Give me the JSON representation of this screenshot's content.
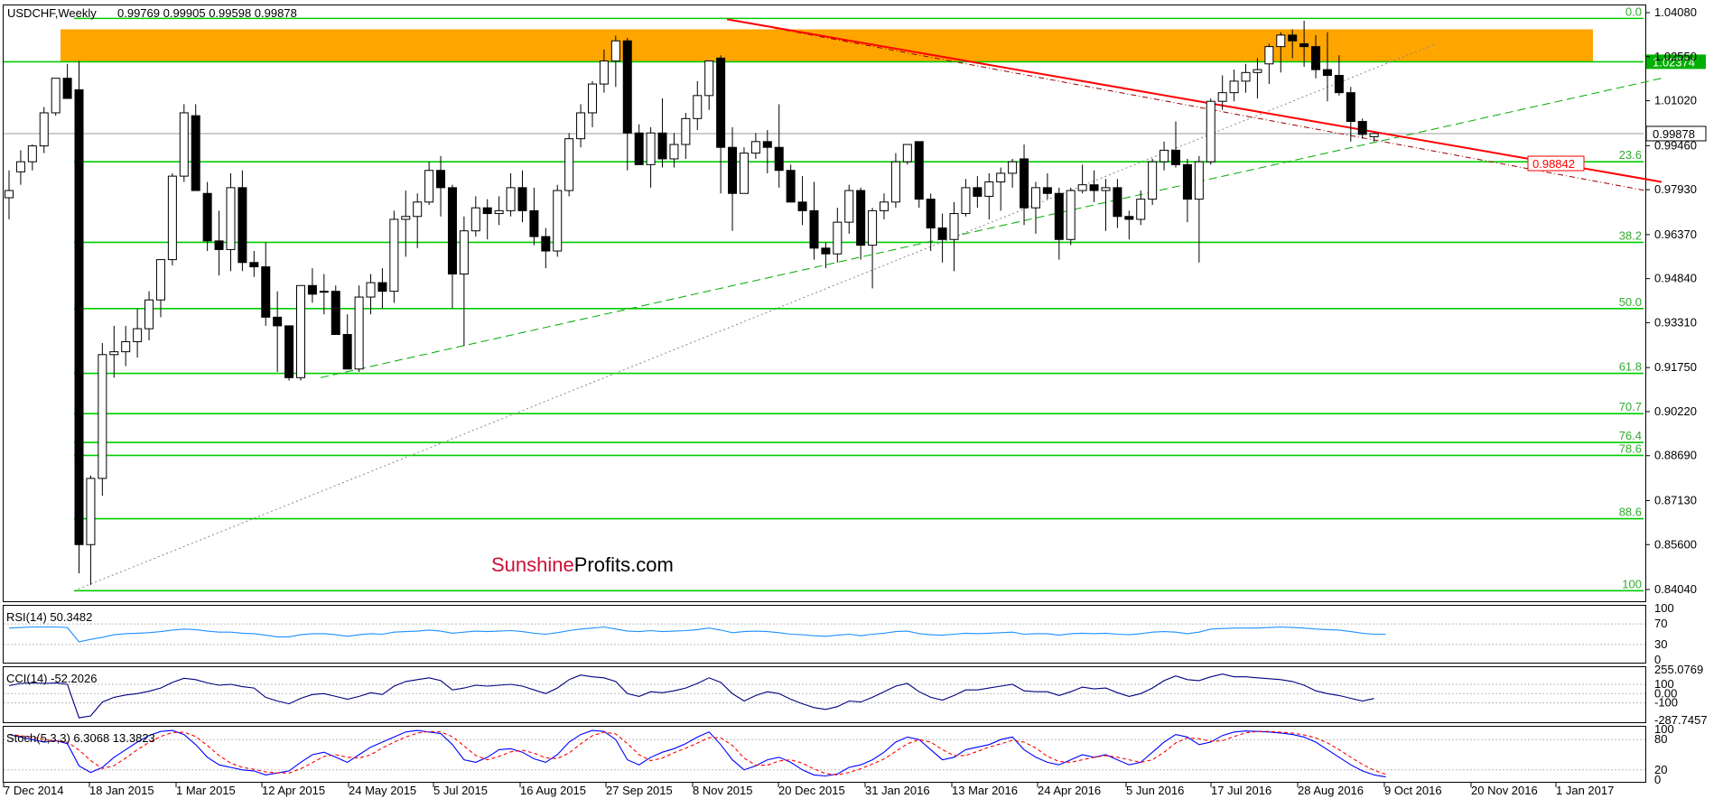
{
  "chart_data": {
    "type": "candlestick",
    "title": "USDCHF,Weekly",
    "ohlc_header": "0.99769 0.99905 0.99598 0.99878",
    "watermark": {
      "part1": "Sunshine",
      "part2": "Profits.com",
      "color1": "#cc1133",
      "color2": "#000000"
    },
    "price_axis_ticks": [
      "1.04080",
      "1.02550",
      "1.01020",
      "0.99460",
      "0.97930",
      "0.96370",
      "0.94840",
      "0.93310",
      "0.91750",
      "0.90220",
      "0.88690",
      "0.87130",
      "0.85600",
      "0.84040"
    ],
    "x_tick_labels": [
      "7 Dec 2014",
      "18 Jan 2015",
      "1 Mar 2015",
      "12 Apr 2015",
      "24 May 2015",
      "5 Jul 2015",
      "16 Aug 2015",
      "27 Sep 2015",
      "8 Nov 2015",
      "20 Dec 2015",
      "31 Jan 2016",
      "13 Mar 2016",
      "24 Apr 2016",
      "5 Jun 2016",
      "17 Jul 2016",
      "28 Aug 2016",
      "9 Oct 2016",
      "20 Nov 2016",
      "1 Jan 2017"
    ],
    "fib_levels": [
      {
        "label": "0.0",
        "price": 1.0388
      },
      {
        "label": "23.6",
        "price": 0.989
      },
      {
        "label": "38.2",
        "price": 0.961
      },
      {
        "label": "50.0",
        "price": 0.938
      },
      {
        "label": "61.8",
        "price": 0.9155
      },
      {
        "label": "70.7",
        "price": 0.9015
      },
      {
        "label": "76.4",
        "price": 0.8915
      },
      {
        "label": "78.6",
        "price": 0.887
      },
      {
        "label": "88.6",
        "price": 0.865
      },
      {
        "label": "100",
        "price": 0.84
      }
    ],
    "resistance_zone": {
      "low": 1.0237,
      "high": 1.035,
      "color": "#ffa500"
    },
    "labels": {
      "resistance": {
        "text": "1.02374",
        "price": 1.02374,
        "bg": "#00b000"
      },
      "current": {
        "text": "0.99878",
        "price": 0.99878
      },
      "trendline": {
        "text": "0.98842",
        "price": 0.98842,
        "color": "#ff0000"
      }
    },
    "candles": [
      [
        0.9765,
        0.986,
        0.969,
        0.979
      ],
      [
        0.9855,
        0.993,
        0.981,
        0.989
      ],
      [
        0.989,
        0.995,
        0.986,
        0.9945
      ],
      [
        0.9945,
        1.008,
        0.992,
        1.006
      ],
      [
        1.006,
        1.018,
        1.005,
        1.018
      ],
      [
        1.018,
        1.023,
        1.012,
        1.011
      ],
      [
        1.014,
        1.024,
        0.846,
        0.856
      ],
      [
        0.856,
        0.88,
        0.842,
        0.879
      ],
      [
        0.879,
        0.926,
        0.873,
        0.922
      ],
      [
        0.922,
        0.932,
        0.914,
        0.923
      ],
      [
        0.923,
        0.932,
        0.918,
        0.9265
      ],
      [
        0.9265,
        0.938,
        0.921,
        0.931
      ],
      [
        0.931,
        0.944,
        0.927,
        0.941
      ],
      [
        0.941,
        0.955,
        0.935,
        0.955
      ],
      [
        0.955,
        0.985,
        0.953,
        0.984
      ],
      [
        0.984,
        1.009,
        0.982,
        1.006
      ],
      [
        1.005,
        1.009,
        0.979,
        0.979
      ],
      [
        0.978,
        0.982,
        0.958,
        0.9615
      ],
      [
        0.9615,
        0.972,
        0.9495,
        0.9585
      ],
      [
        0.9585,
        0.985,
        0.951,
        0.98
      ],
      [
        0.98,
        0.986,
        0.951,
        0.954
      ],
      [
        0.954,
        0.958,
        0.949,
        0.9525
      ],
      [
        0.9525,
        0.961,
        0.932,
        0.935
      ],
      [
        0.935,
        0.944,
        0.916,
        0.932
      ],
      [
        0.932,
        0.928,
        0.913,
        0.914
      ],
      [
        0.914,
        0.945,
        0.913,
        0.946
      ],
      [
        0.946,
        0.952,
        0.94,
        0.943
      ],
      [
        0.944,
        0.95,
        0.936,
        0.944
      ],
      [
        0.944,
        0.946,
        0.929,
        0.929
      ],
      [
        0.929,
        0.936,
        0.918,
        0.917
      ],
      [
        0.917,
        0.946,
        0.916,
        0.942
      ],
      [
        0.942,
        0.95,
        0.936,
        0.947
      ],
      [
        0.947,
        0.952,
        0.938,
        0.944
      ],
      [
        0.944,
        0.972,
        0.94,
        0.969
      ],
      [
        0.969,
        0.979,
        0.956,
        0.97
      ],
      [
        0.97,
        0.978,
        0.959,
        0.975
      ],
      [
        0.975,
        0.989,
        0.974,
        0.986
      ],
      [
        0.986,
        0.991,
        0.97,
        0.98
      ],
      [
        0.98,
        0.981,
        0.938,
        0.95
      ],
      [
        0.95,
        0.97,
        0.925,
        0.965
      ],
      [
        0.965,
        0.977,
        0.963,
        0.973
      ],
      [
        0.973,
        0.976,
        0.962,
        0.971
      ],
      [
        0.971,
        0.977,
        0.967,
        0.972
      ],
      [
        0.972,
        0.985,
        0.97,
        0.98
      ],
      [
        0.98,
        0.986,
        0.968,
        0.972
      ],
      [
        0.972,
        0.98,
        0.96,
        0.963
      ],
      [
        0.963,
        0.966,
        0.952,
        0.958
      ],
      [
        0.958,
        0.981,
        0.956,
        0.979
      ],
      [
        0.979,
        0.999,
        0.977,
        0.997
      ],
      [
        0.997,
        1.009,
        0.994,
        1.006
      ],
      [
        1.006,
        1.017,
        1.001,
        1.016
      ],
      [
        1.016,
        1.028,
        1.013,
        1.024
      ],
      [
        1.024,
        1.0328,
        1.015,
        1.031
      ],
      [
        1.031,
        1.032,
        0.986,
        0.999
      ],
      [
        0.999,
        1.002,
        0.988,
        0.988
      ],
      [
        0.988,
        1.001,
        0.98,
        0.999
      ],
      [
        0.999,
        1.011,
        0.987,
        0.99
      ],
      [
        0.99,
        0.999,
        0.987,
        0.995
      ],
      [
        0.995,
        1.006,
        0.99,
        1.004
      ],
      [
        1.004,
        1.017,
        1.0,
        1.012
      ],
      [
        1.012,
        1.024,
        1.007,
        1.024
      ],
      [
        1.025,
        1.026,
        0.978,
        0.994
      ],
      [
        0.994,
        1.001,
        0.965,
        0.978
      ],
      [
        0.978,
        0.994,
        0.979,
        0.992
      ],
      [
        0.992,
        0.999,
        0.99,
        0.996
      ],
      [
        0.996,
        1.0,
        0.985,
        0.994
      ],
      [
        0.994,
        1.009,
        0.98,
        0.986
      ],
      [
        0.986,
        0.988,
        0.975,
        0.975
      ],
      [
        0.975,
        0.984,
        0.967,
        0.972
      ],
      [
        0.972,
        0.982,
        0.955,
        0.959
      ],
      [
        0.959,
        0.961,
        0.952,
        0.957
      ],
      [
        0.957,
        0.973,
        0.954,
        0.968
      ],
      [
        0.968,
        0.981,
        0.964,
        0.979
      ],
      [
        0.979,
        0.98,
        0.955,
        0.96
      ],
      [
        0.96,
        0.973,
        0.945,
        0.972
      ],
      [
        0.972,
        0.978,
        0.969,
        0.975
      ],
      [
        0.975,
        0.992,
        0.973,
        0.989
      ],
      [
        0.989,
        0.995,
        0.988,
        0.995
      ],
      [
        0.996,
        0.996,
        0.973,
        0.976
      ],
      [
        0.976,
        0.978,
        0.958,
        0.966
      ],
      [
        0.966,
        0.971,
        0.954,
        0.962
      ],
      [
        0.962,
        0.975,
        0.951,
        0.971
      ],
      [
        0.971,
        0.983,
        0.97,
        0.98
      ],
      [
        0.98,
        0.984,
        0.973,
        0.977
      ],
      [
        0.977,
        0.985,
        0.969,
        0.982
      ],
      [
        0.982,
        0.987,
        0.972,
        0.985
      ],
      [
        0.985,
        0.99,
        0.98,
        0.989
      ],
      [
        0.99,
        0.995,
        0.967,
        0.973
      ],
      [
        0.973,
        0.982,
        0.964,
        0.98
      ],
      [
        0.98,
        0.985,
        0.976,
        0.978
      ],
      [
        0.978,
        0.98,
        0.955,
        0.962
      ],
      [
        0.962,
        0.98,
        0.96,
        0.979
      ],
      [
        0.979,
        0.988,
        0.978,
        0.981
      ],
      [
        0.981,
        0.986,
        0.975,
        0.979
      ],
      [
        0.979,
        0.983,
        0.965,
        0.98
      ],
      [
        0.98,
        0.983,
        0.966,
        0.97
      ],
      [
        0.97,
        0.972,
        0.962,
        0.969
      ],
      [
        0.969,
        0.979,
        0.967,
        0.976
      ],
      [
        0.976,
        0.99,
        0.974,
        0.989
      ],
      [
        0.989,
        0.996,
        0.986,
        0.993
      ],
      [
        0.993,
        1.003,
        0.987,
        0.988
      ],
      [
        0.988,
        0.99,
        0.968,
        0.976
      ],
      [
        0.976,
        0.991,
        0.954,
        0.989
      ],
      [
        0.989,
        1.011,
        0.988,
        1.01
      ],
      [
        1.01,
        1.019,
        1.007,
        1.013
      ],
      [
        1.013,
        1.021,
        1.01,
        1.017
      ],
      [
        1.017,
        1.023,
        1.013,
        1.02
      ],
      [
        1.02,
        1.025,
        1.011,
        1.021
      ],
      [
        1.023,
        1.03,
        1.016,
        1.029
      ],
      [
        1.029,
        1.034,
        1.02,
        1.033
      ],
      [
        1.033,
        1.035,
        1.025,
        1.031
      ],
      [
        1.03,
        1.038,
        1.022,
        1.029
      ],
      [
        1.029,
        1.033,
        1.018,
        1.021
      ],
      [
        1.021,
        1.034,
        1.01,
        1.019
      ],
      [
        1.019,
        1.026,
        1.012,
        1.013
      ],
      [
        1.013,
        1.015,
        0.996,
        1.003
      ],
      [
        1.003,
        1.004,
        0.997,
        0.9985
      ],
      [
        0.9977,
        0.9991,
        0.996,
        0.9988
      ]
    ],
    "rsi": {
      "label": "RSI(14) 50.3482",
      "ticks": [
        "100",
        "70",
        "30",
        "0"
      ],
      "values": [
        62,
        63,
        64,
        64,
        64,
        63,
        35,
        40,
        44,
        49,
        51,
        52,
        53,
        55,
        58,
        60,
        59,
        56,
        54,
        54,
        52,
        51,
        48,
        45,
        45,
        49,
        51,
        51,
        49,
        46,
        49,
        51,
        50,
        54,
        55,
        56,
        58,
        56,
        52,
        54,
        56,
        55,
        56,
        57,
        55,
        52,
        50,
        53,
        57,
        60,
        62,
        64,
        60,
        56,
        55,
        57,
        55,
        56,
        57,
        59,
        62,
        58,
        53,
        55,
        56,
        55,
        53,
        50,
        49,
        47,
        46,
        48,
        50,
        47,
        50,
        52,
        55,
        56,
        51,
        49,
        48,
        50,
        52,
        51,
        52,
        53,
        54,
        50,
        51,
        51,
        48,
        51,
        52,
        51,
        52,
        50,
        49,
        51,
        54,
        55,
        54,
        51,
        54,
        60,
        61,
        62,
        62,
        62,
        63,
        64,
        63,
        62,
        60,
        59,
        58,
        55,
        52,
        50,
        50
      ]
    },
    "cci": {
      "label": "CCI(14) -52.2026",
      "ticks": [
        "255.0769",
        "100",
        "0.00",
        "-100",
        "-287.7457"
      ],
      "values": [
        85,
        110,
        115,
        110,
        115,
        100,
        -260,
        -240,
        -90,
        -40,
        -15,
        0,
        25,
        60,
        120,
        165,
        150,
        115,
        90,
        100,
        75,
        60,
        -40,
        -80,
        -110,
        -50,
        -10,
        0,
        -30,
        -60,
        -30,
        10,
        -10,
        80,
        130,
        150,
        170,
        140,
        40,
        60,
        90,
        80,
        90,
        100,
        80,
        40,
        0,
        60,
        150,
        200,
        180,
        170,
        130,
        0,
        -30,
        20,
        10,
        30,
        60,
        110,
        170,
        120,
        0,
        -80,
        -20,
        20,
        0,
        -60,
        -110,
        -150,
        -170,
        -140,
        -80,
        -90,
        -40,
        20,
        80,
        110,
        20,
        -40,
        -70,
        -20,
        40,
        40,
        60,
        80,
        100,
        30,
        20,
        20,
        -20,
        20,
        70,
        50,
        60,
        10,
        -30,
        0,
        60,
        140,
        190,
        150,
        140,
        180,
        210,
        180,
        180,
        170,
        160,
        150,
        130,
        90,
        30,
        0,
        -20,
        -50,
        -80,
        -52
      ]
    },
    "stoch": {
      "label": "Stoch(5,3,3) 6.3068 13.3823",
      "ticks": [
        "100",
        "80",
        "20",
        "0"
      ],
      "main": [
        90,
        85,
        80,
        75,
        78,
        72,
        28,
        15,
        25,
        45,
        60,
        75,
        88,
        96,
        98,
        90,
        70,
        45,
        30,
        25,
        20,
        18,
        10,
        14,
        18,
        35,
        50,
        55,
        45,
        35,
        50,
        65,
        75,
        85,
        95,
        98,
        95,
        92,
        70,
        40,
        35,
        45,
        60,
        62,
        55,
        42,
        35,
        50,
        75,
        90,
        98,
        96,
        80,
        40,
        30,
        45,
        55,
        62,
        72,
        85,
        95,
        70,
        40,
        20,
        28,
        40,
        45,
        35,
        20,
        10,
        8,
        12,
        25,
        30,
        40,
        55,
        75,
        85,
        80,
        60,
        40,
        45,
        60,
        65,
        70,
        80,
        85,
        60,
        45,
        35,
        30,
        40,
        50,
        45,
        50,
        40,
        30,
        35,
        55,
        75,
        90,
        85,
        70,
        75,
        88,
        95,
        97,
        96,
        95,
        93,
        90,
        85,
        75,
        60,
        45,
        30,
        18,
        10,
        6
      ]
    },
    "stoch_signal": {
      "color": "#ff0000"
    },
    "colors": {
      "fib": "#00cc00",
      "trend_red": "#ff0000",
      "trend_green": "#00aa00",
      "dash_brown": "#990000",
      "dot_gray": "#888888",
      "rsi_line": "#1e90ff",
      "cci_line": "#000080",
      "stoch_main": "#0000ff",
      "stoch_signal": "#ff0000"
    }
  }
}
